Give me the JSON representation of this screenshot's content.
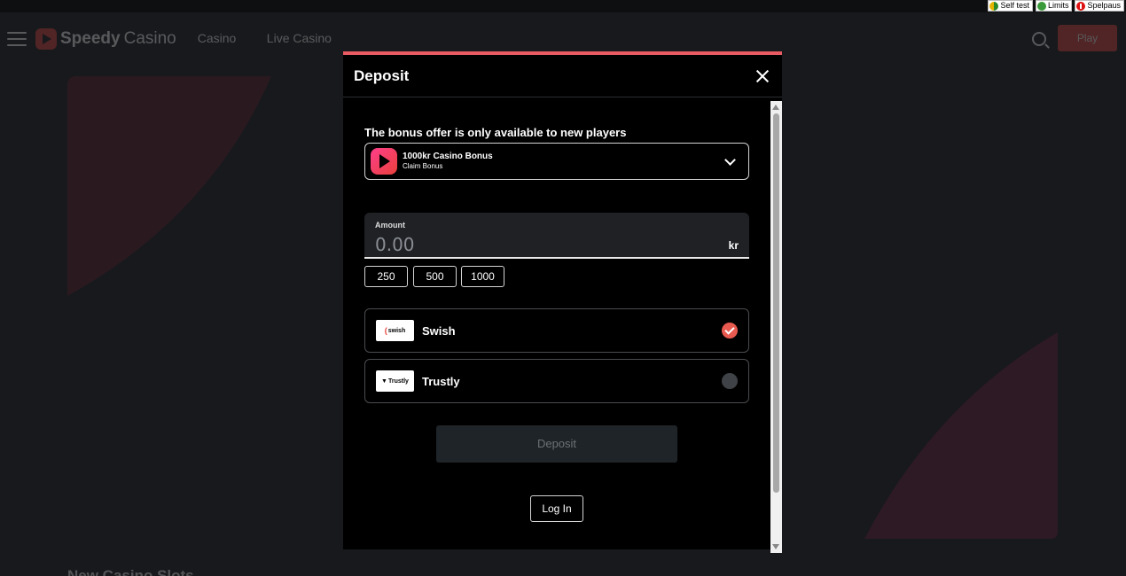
{
  "compliance_bar": {
    "self_test": "Self test",
    "limits": "Limits",
    "spelpaus": "Spelpaus"
  },
  "header": {
    "logo_bold": "Speedy",
    "logo_light": "Casino",
    "nav": [
      "Casino",
      "Live Casino"
    ],
    "play_label": "Play"
  },
  "page": {
    "bottom_heading": "New Casino Slots"
  },
  "modal": {
    "title": "Deposit",
    "bonus_note": "The bonus offer is only available to new players",
    "bonus": {
      "name": "1000kr Casino Bonus",
      "sub": "Claim Bonus"
    },
    "amount": {
      "label": "Amount",
      "placeholder": "0.00",
      "currency": "kr"
    },
    "quick_amounts": [
      "250",
      "500",
      "1000"
    ],
    "payment_methods": [
      {
        "name": "Swish",
        "logo_text": "swish",
        "selected": true
      },
      {
        "name": "Trustly",
        "logo_text": "Trustly",
        "selected": false
      }
    ],
    "deposit_label": "Deposit",
    "login_label": "Log In"
  },
  "colors": {
    "accent": "#e85a62",
    "background": "#17191c",
    "modal_bg": "#000000",
    "selected_radio": "#e85a4f"
  }
}
